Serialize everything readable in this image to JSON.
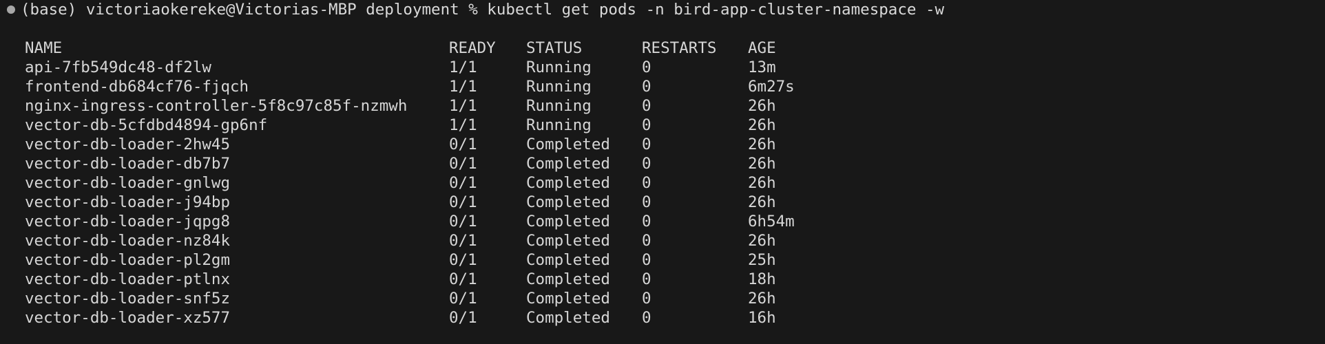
{
  "terminal": {
    "prompt": "(base) victoriaokereke@Victorias-MBP deployment % kubectl get pods -n bird-app-cluster-namespace -w",
    "columns": [
      "NAME",
      "READY",
      "STATUS",
      "RESTARTS",
      "AGE"
    ],
    "rows": [
      {
        "name": "api-7fb549dc48-df2lw",
        "ready": "1/1",
        "status": "Running",
        "restarts": "0",
        "age": "13m"
      },
      {
        "name": "frontend-db684cf76-fjqch",
        "ready": "1/1",
        "status": "Running",
        "restarts": "0",
        "age": "6m27s"
      },
      {
        "name": "nginx-ingress-controller-5f8c97c85f-nzmwh",
        "ready": "1/1",
        "status": "Running",
        "restarts": "0",
        "age": "26h"
      },
      {
        "name": "vector-db-5cfdbd4894-gp6nf",
        "ready": "1/1",
        "status": "Running",
        "restarts": "0",
        "age": "26h"
      },
      {
        "name": "vector-db-loader-2hw45",
        "ready": "0/1",
        "status": "Completed",
        "restarts": "0",
        "age": "26h"
      },
      {
        "name": "vector-db-loader-db7b7",
        "ready": "0/1",
        "status": "Completed",
        "restarts": "0",
        "age": "26h"
      },
      {
        "name": "vector-db-loader-gnlwg",
        "ready": "0/1",
        "status": "Completed",
        "restarts": "0",
        "age": "26h"
      },
      {
        "name": "vector-db-loader-j94bp",
        "ready": "0/1",
        "status": "Completed",
        "restarts": "0",
        "age": "26h"
      },
      {
        "name": "vector-db-loader-jqpg8",
        "ready": "0/1",
        "status": "Completed",
        "restarts": "0",
        "age": "6h54m"
      },
      {
        "name": "vector-db-loader-nz84k",
        "ready": "0/1",
        "status": "Completed",
        "restarts": "0",
        "age": "26h"
      },
      {
        "name": "vector-db-loader-pl2gm",
        "ready": "0/1",
        "status": "Completed",
        "restarts": "0",
        "age": "25h"
      },
      {
        "name": "vector-db-loader-ptlnx",
        "ready": "0/1",
        "status": "Completed",
        "restarts": "0",
        "age": "18h"
      },
      {
        "name": "vector-db-loader-snf5z",
        "ready": "0/1",
        "status": "Completed",
        "restarts": "0",
        "age": "26h"
      },
      {
        "name": "vector-db-loader-xz577",
        "ready": "0/1",
        "status": "Completed",
        "restarts": "0",
        "age": "16h"
      }
    ]
  },
  "colors": {
    "background": "#181818",
    "text": "#d6d6d6",
    "prompt_marker": "#a7a7a7"
  }
}
